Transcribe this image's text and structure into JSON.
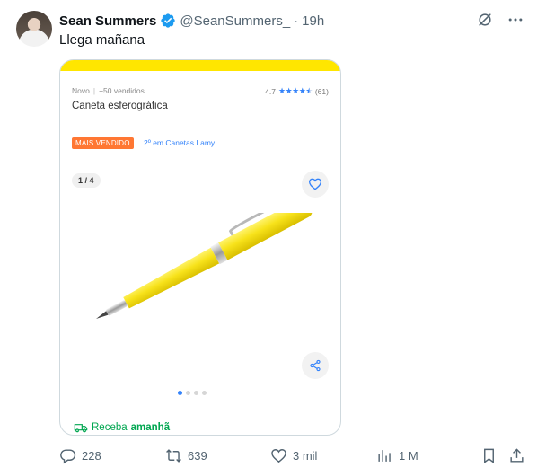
{
  "author": {
    "name": "Sean Summers",
    "handle": "@SeanSummers_",
    "separator": "·",
    "time": "19h"
  },
  "tweet": {
    "text": "Llega mañana"
  },
  "product": {
    "condition": "Novo",
    "separator": "|",
    "sold": "+50 vendidos",
    "rating_value": "4.7",
    "rating_stars": 4.5,
    "rating_count": "(61)",
    "title": "Caneta esferográfica",
    "badge": "MAIS VENDIDO",
    "category_link": "2º em Canetas Lamy",
    "image_counter": "1 / 4",
    "carousel_dots": 4,
    "carousel_active": 0,
    "delivery_prefix": "Receba",
    "delivery_day": "amanhã",
    "colors": {
      "brand_yellow": "#ffe600",
      "badge_orange": "#ff7733",
      "link_blue": "#3483fa",
      "delivery_green": "#00a650",
      "pen_yellow": "#f7e21a"
    }
  },
  "actions": {
    "replies": "228",
    "reposts": "639",
    "likes": "3 mil",
    "views": "1 M"
  },
  "icons": {
    "verified": "verified-badge-icon",
    "grok": "grok-icon",
    "more": "more-icon",
    "reply": "reply-icon",
    "repost": "repost-icon",
    "like": "heart-icon",
    "views": "views-icon",
    "bookmark": "bookmark-icon",
    "share": "share-icon"
  }
}
